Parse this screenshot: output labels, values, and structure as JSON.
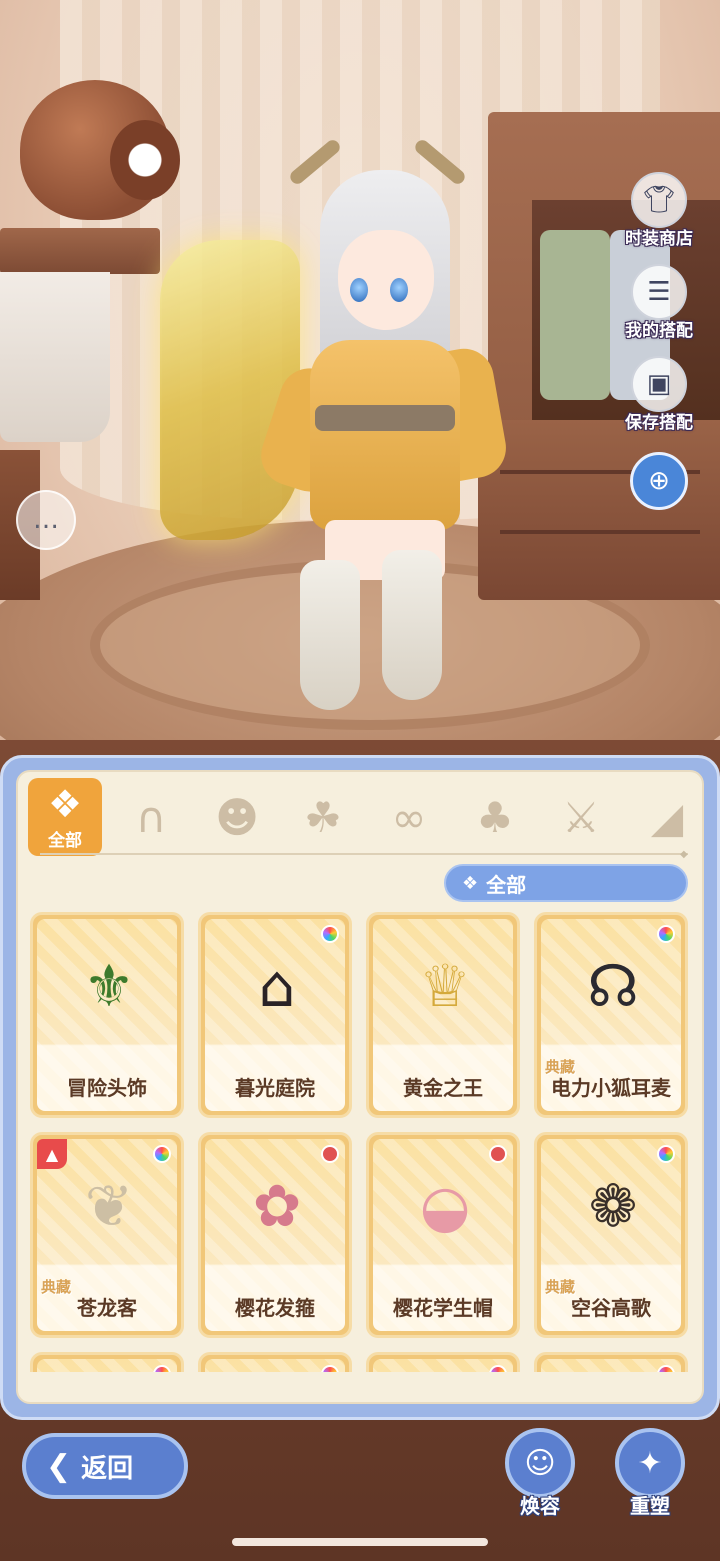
{
  "side_menu": {
    "fashion_shop": "时装商店",
    "my_outfits": "我的搭配",
    "save_outfit": "保存搭配"
  },
  "icons": {
    "fashion_shop": "shirt-icon",
    "my_outfits": "hanger-icon",
    "save_outfit": "floppy-disk-icon",
    "zoom": "zoom-in-icon",
    "chat": "chat-bubbles-icon"
  },
  "category_tabs": [
    {
      "label": "全部",
      "icon": "grid-icon",
      "active": true
    },
    {
      "label": "",
      "icon": "cat-ears-icon",
      "active": false
    },
    {
      "label": "",
      "icon": "mask-icon",
      "active": false
    },
    {
      "label": "",
      "icon": "hair-icon",
      "active": false
    },
    {
      "label": "",
      "icon": "eye-mask-icon",
      "active": false
    },
    {
      "label": "",
      "icon": "outfit-icon",
      "active": false
    },
    {
      "label": "",
      "icon": "sword-icon",
      "active": false
    },
    {
      "label": "",
      "icon": "wing-icon",
      "active": false
    }
  ],
  "filter": {
    "label": "全部"
  },
  "items": [
    {
      "name": "冒险头饰",
      "tag": "",
      "color_dot": "",
      "badge": false
    },
    {
      "name": "暮光庭院",
      "tag": "",
      "color_dot": "rainbow",
      "badge": false
    },
    {
      "name": "黄金之王",
      "tag": "",
      "color_dot": "",
      "badge": false
    },
    {
      "name": "电力小狐耳麦",
      "tag": "典藏",
      "color_dot": "rainbow",
      "badge": false
    },
    {
      "name": "苍龙客",
      "tag": "典藏",
      "color_dot": "rainbow",
      "badge": true
    },
    {
      "name": "樱花发箍",
      "tag": "",
      "color_dot": "red",
      "badge": false
    },
    {
      "name": "樱花学生帽",
      "tag": "",
      "color_dot": "red",
      "badge": false
    },
    {
      "name": "空谷高歌",
      "tag": "典藏",
      "color_dot": "rainbow",
      "badge": false
    }
  ],
  "footer": {
    "back": "返回",
    "makeover": "焕容",
    "reshape": "重塑"
  },
  "colors": {
    "accent_blue": "#5b7fcf",
    "tab_active": "#f0a43c",
    "card_gold": "#f1c779",
    "collection_tag": "#d9a357"
  }
}
